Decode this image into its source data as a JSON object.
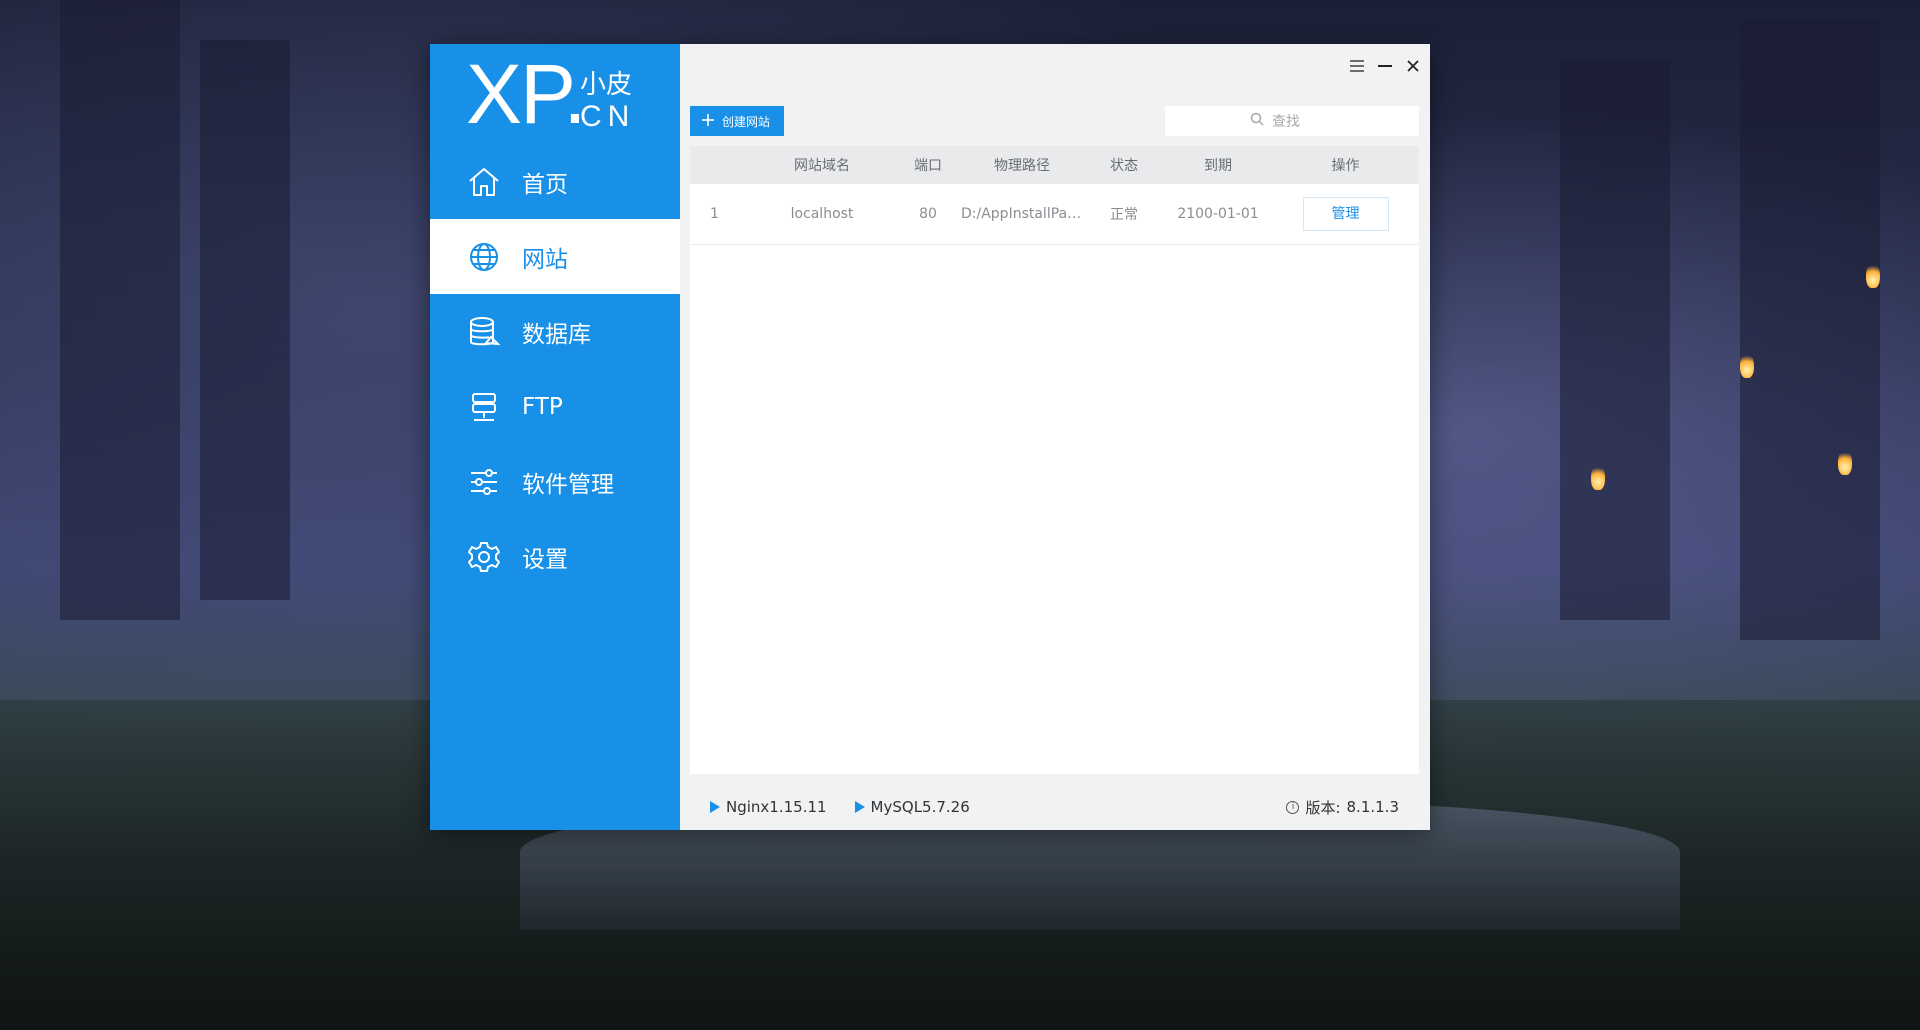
{
  "colors": {
    "accent": "#1890e8",
    "sidebar_bg": "#1890e8",
    "main_bg": "#f1f2f4"
  },
  "logo": {
    "main": "XP.",
    "cn_top": "小皮",
    "cn_bottom": "CN"
  },
  "sidebar": {
    "items": [
      {
        "label": "首页",
        "icon": "home-icon",
        "active": false
      },
      {
        "label": "网站",
        "icon": "globe-icon",
        "active": true
      },
      {
        "label": "数据库",
        "icon": "database-icon",
        "active": false
      },
      {
        "label": "FTP",
        "icon": "ftp-server-icon",
        "active": false
      },
      {
        "label": "软件管理",
        "icon": "sliders-icon",
        "active": false
      },
      {
        "label": "设置",
        "icon": "gear-icon",
        "active": false
      }
    ]
  },
  "window_controls": {
    "menu": "menu-icon",
    "minimize": "minimize-icon",
    "close": "close-icon"
  },
  "toolbar": {
    "create_label": "创建网站",
    "search_placeholder": "查找"
  },
  "table": {
    "columns": [
      "",
      "网站域名",
      "端口",
      "物理路径",
      "状态",
      "到期",
      "操作"
    ],
    "rows": [
      {
        "index": "1",
        "domain": "localhost",
        "port": "80",
        "path": "D:/AppInstallPath/P...",
        "status": "正常",
        "expiry": "2100-01-01",
        "action": "管理"
      }
    ]
  },
  "statusbar": {
    "services": [
      "Nginx1.15.11",
      "MySQL5.7.26"
    ],
    "version_label": "版本:",
    "version_value": "8.1.1.3"
  }
}
